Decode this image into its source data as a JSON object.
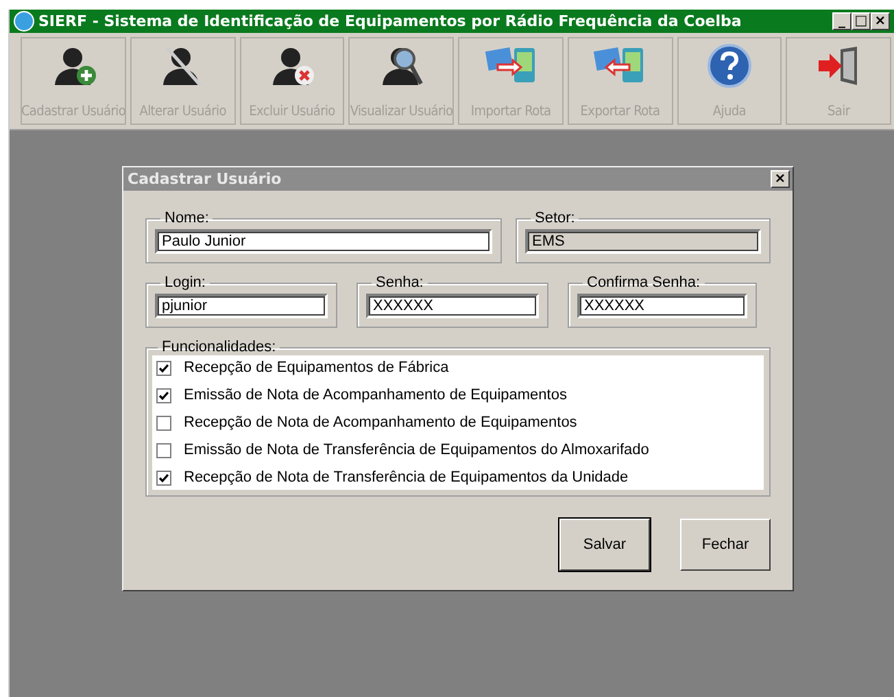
{
  "window": {
    "title": "SIERF - Sistema de Identificação de Equipamentos por Rádio Frequência da Coelba",
    "controls": [
      "_",
      "□",
      "×"
    ]
  },
  "toolbar": [
    {
      "label": "Cadastrar Usuário",
      "kind": "user-add"
    },
    {
      "label": "Alterar Usuário",
      "kind": "user-edit"
    },
    {
      "label": "Excluir Usuário",
      "kind": "user-delete"
    },
    {
      "label": "Visualizar Usuário",
      "kind": "user-view"
    },
    {
      "label": "Importar Rota",
      "kind": "import"
    },
    {
      "label": "Exportar Rota",
      "kind": "export"
    },
    {
      "label": "Ajuda",
      "kind": "help"
    },
    {
      "label": "Sair",
      "kind": "exit"
    }
  ],
  "dialog": {
    "title": "Cadastrar Usuário",
    "close": "×",
    "nome": {
      "label": "Nome:",
      "value": "Paulo Junior"
    },
    "setor": {
      "label": "Setor:",
      "value": "EMS",
      "disabled": true
    },
    "login": {
      "label": "Login:",
      "value": "pjunior"
    },
    "senha": {
      "label": "Senha:",
      "value": "XXXXXX"
    },
    "confirma": {
      "label": "Confirma Senha:",
      "value": "XXXXXX"
    },
    "funcionalidades": {
      "label": "Funcionalidades:",
      "items": [
        {
          "label": "Recepção de Equipamentos de Fábrica",
          "checked": true
        },
        {
          "label": "Emissão de Nota de Acompanhamento de Equipamentos",
          "checked": true
        },
        {
          "label": "Recepção de Nota de Acompanhamento de Equipamentos",
          "checked": false
        },
        {
          "label": "Emissão de Nota de Transferência de Equipamentos do Almoxarifado",
          "checked": false
        },
        {
          "label": "Recepção de Nota de Transferência de Equipamentos da Unidade",
          "checked": true
        }
      ]
    },
    "buttons": [
      {
        "label": "Salvar",
        "default": true
      },
      {
        "label": "Fechar",
        "default": false
      }
    ]
  }
}
